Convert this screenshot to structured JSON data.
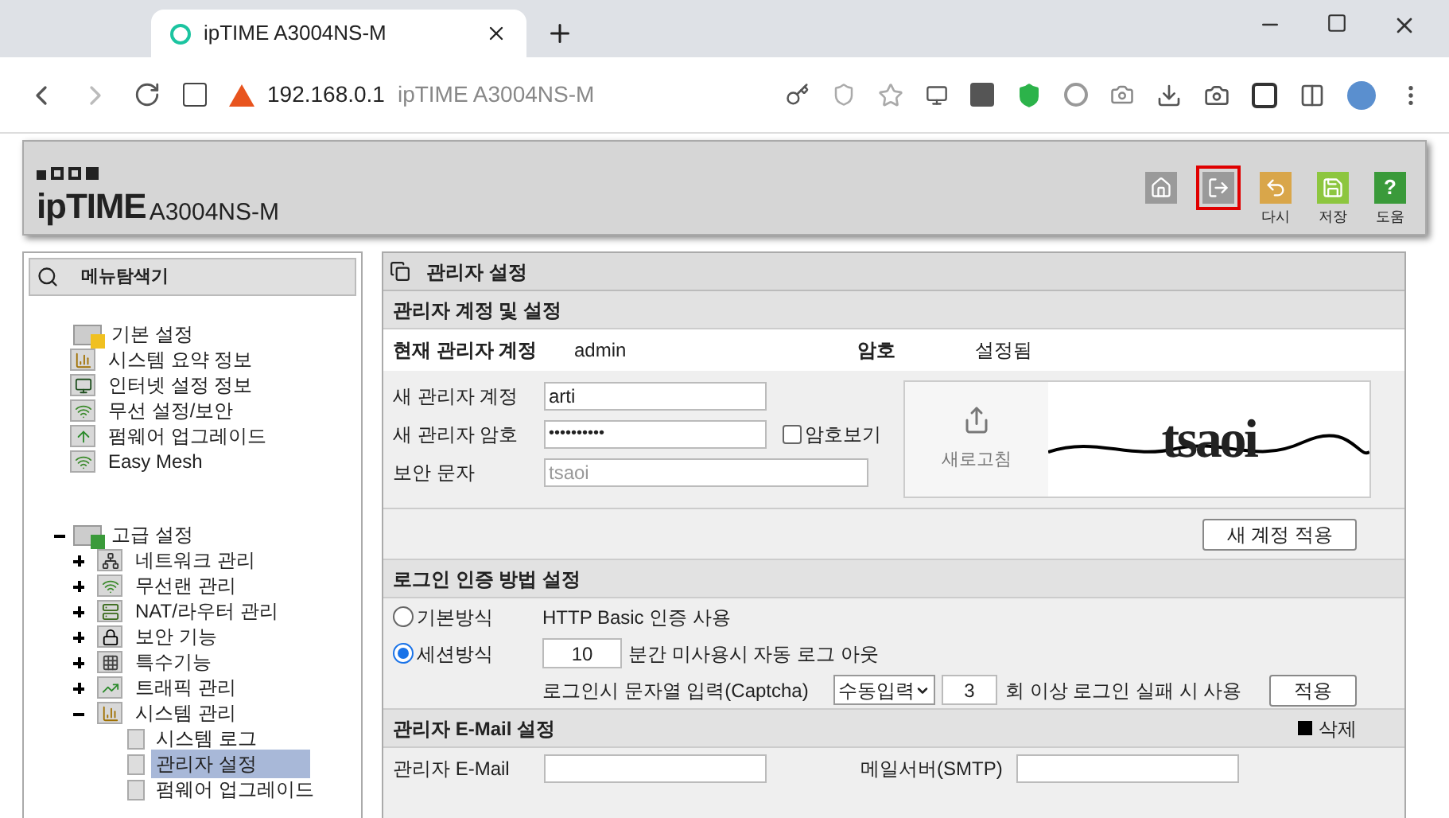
{
  "browser": {
    "tab_title": "ipTIME A3004NS-M",
    "url_host": "192.168.0.1",
    "url_title": "ipTIME A3004NS-M",
    "secure": false
  },
  "header": {
    "brand": "ipTIME",
    "model": "A3004NS-M",
    "buttons": [
      {
        "kind": "home",
        "highlighted": false
      },
      {
        "kind": "logout",
        "highlighted": true
      },
      {
        "kind": "reload",
        "label": "다시",
        "highlighted": false
      },
      {
        "kind": "save",
        "label": "저장",
        "highlighted": false
      },
      {
        "kind": "help",
        "glyph": "?",
        "label": "도움",
        "highlighted": false
      }
    ]
  },
  "sidebar": {
    "title": "메뉴탐색기",
    "groups": [
      {
        "label": "기본 설정",
        "kind": "basic",
        "children": [
          {
            "label": "시스템 요약 정보",
            "kind": "chart",
            "selected": false
          },
          {
            "label": "인터넷 설정 정보",
            "kind": "monitor",
            "selected": false
          },
          {
            "label": "무선 설정/보안",
            "kind": "wifi",
            "selected": false
          },
          {
            "label": "펌웨어 업그레이드",
            "kind": "upload",
            "selected": false
          },
          {
            "label": "Easy Mesh",
            "kind": "wifi",
            "selected": false
          }
        ]
      },
      {
        "label": "고급 설정",
        "kind": "advanced",
        "expanded": true,
        "children": [
          {
            "label": "네트워크 관리",
            "kind": "network",
            "expanded": false,
            "selected": false
          },
          {
            "label": "무선랜 관리",
            "kind": "wifi",
            "expanded": false,
            "selected": false
          },
          {
            "label": "NAT/라우터 관리",
            "kind": "router",
            "expanded": false,
            "selected": false
          },
          {
            "label": "보안 기능",
            "kind": "lock",
            "expanded": false,
            "selected": false
          },
          {
            "label": "특수기능",
            "kind": "grid",
            "expanded": false,
            "selected": false
          },
          {
            "label": "트래픽 관리",
            "kind": "traffic",
            "expanded": false,
            "selected": false
          },
          {
            "label": "시스템 관리",
            "kind": "chart",
            "expanded": true,
            "selected": false,
            "children": [
              {
                "label": "시스템 로그",
                "selected": false
              },
              {
                "label": "관리자 설정",
                "selected": true
              },
              {
                "label": "펌웨어 업그레이드",
                "selected": false
              }
            ]
          }
        ]
      }
    ]
  },
  "main": {
    "title": "관리자 설정",
    "account": {
      "title": "관리자 계정 및 설정",
      "current_label": "현재 관리자 계정",
      "current_value": "admin",
      "password_label": "암호",
      "password_value": "설정됨",
      "new_account_label": "새 관리자 계정",
      "new_account_value": "arti",
      "new_password_label": "새 관리자 암호",
      "new_password_value": "••••••••••",
      "show_password": {
        "label": "암호보기",
        "checked": false
      },
      "captcha_label": "보안 문자",
      "captcha_value": "tsaoi",
      "refresh_label": "새로고침",
      "captcha_text": "tsaoi",
      "apply_button": "새 계정 적용"
    },
    "login": {
      "title": "로그인 인증 방법 설정",
      "options": [
        {
          "label": "기본방식",
          "selected": false
        },
        {
          "label": "세션방식",
          "selected": true
        }
      ],
      "basic_text": "HTTP Basic 인증 사용",
      "timeout_value": "10",
      "timeout_text": "분간 미사용시 자동 로그 아웃",
      "captcha_label": "로그인시 문자열 입력(Captcha)",
      "captcha_mode": "수동입력",
      "fail_count": "3",
      "fail_text": "회 이상 로그인 실패 시 사용",
      "apply_button": "적용"
    },
    "email": {
      "title": "관리자 E-Mail 설정",
      "delete_button": "삭제",
      "admin_email_label": "관리자 E-Mail",
      "smtp_label": "메일서버(SMTP)"
    }
  }
}
